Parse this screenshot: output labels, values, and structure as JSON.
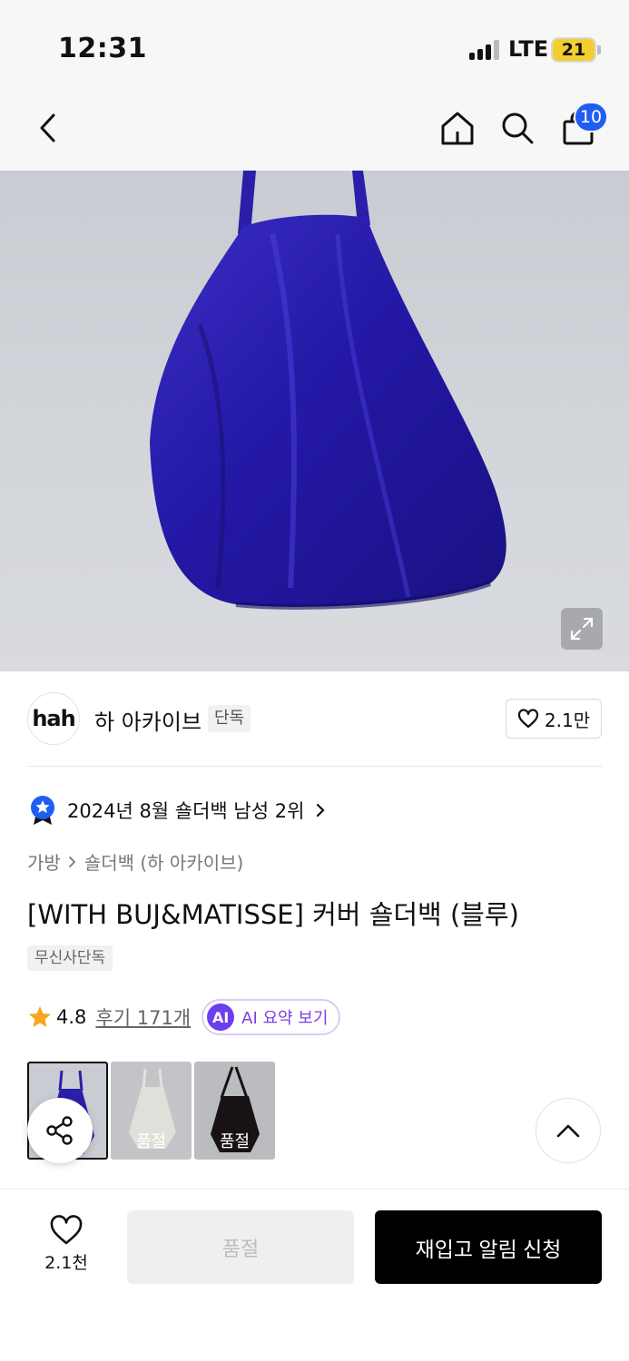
{
  "status_bar": {
    "time": "12:31",
    "network": "LTE",
    "battery": "21"
  },
  "nav": {
    "cart_count": "10"
  },
  "brand": {
    "logo_text": "hah",
    "name": "하 아카이브",
    "tag": "단독",
    "likes": "2.1만"
  },
  "ranking": {
    "text": "2024년 8월 숄더백 남성 2위"
  },
  "breadcrumb": {
    "level1": "가방",
    "level2": "숄더백 (하 아카이브)"
  },
  "product": {
    "title": "[WITH BUJ&MATISSE] 커버 숄더백 (블루)",
    "exclusive_tag": "무신사단독",
    "rating": "4.8",
    "reviews": "후기 171개",
    "ai_badge": "AI",
    "ai_label": "AI 요약 보기"
  },
  "options": [
    {
      "label": "",
      "color": "#2a1fa8"
    },
    {
      "label": "품절",
      "color": "#efeee8"
    },
    {
      "label": "품절",
      "color": "#1b1416"
    }
  ],
  "bottom_bar": {
    "wish_count": "2.1천",
    "soldout_label": "품절",
    "restock_label": "재입고 알림 신청"
  },
  "colors": {
    "accent_blue": "#1f5ef2",
    "ai_purple": "#6c3ef0",
    "star": "#f5a623"
  }
}
